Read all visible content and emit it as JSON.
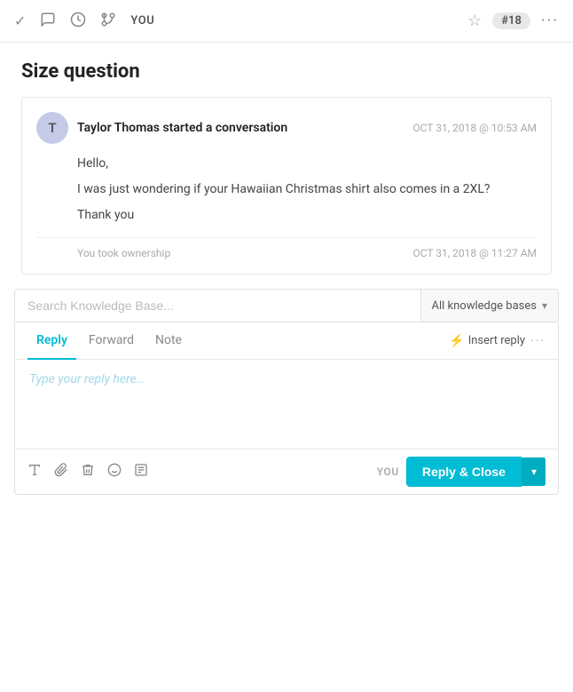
{
  "toolbar": {
    "label": "YOU",
    "ticket_badge": "#18",
    "icons": {
      "check": "✓",
      "chat": "□",
      "clock": "○",
      "fork": "⑂",
      "star": "☆",
      "more": "···"
    }
  },
  "page": {
    "title": "Size question"
  },
  "conversation": {
    "author_initial": "T",
    "author_action": "Taylor Thomas started a conversation",
    "timestamp": "OCT 31, 2018 @ 10:53 AM",
    "lines": [
      "Hello,",
      "I was just wondering if your Hawaiian Christmas shirt also comes in a 2XL?",
      "Thank you"
    ],
    "ownership_text": "You took ownership",
    "ownership_time": "OCT 31, 2018 @ 11:27 AM"
  },
  "knowledge_base": {
    "search_placeholder": "Search Knowledge Base...",
    "dropdown_label": "All knowledge bases",
    "dropdown_arrow": "▾"
  },
  "reply": {
    "tabs": [
      {
        "label": "Reply",
        "active": true
      },
      {
        "label": "Forward",
        "active": false
      },
      {
        "label": "Note",
        "active": false
      }
    ],
    "insert_label": "Insert reply",
    "placeholder": "Type your reply here...",
    "you_label": "YOU",
    "send_label": "Reply & Close",
    "send_dropdown": "▾",
    "tools": {
      "text": "A",
      "attach": "📎",
      "delete": "🗑",
      "emoji": "☺",
      "article": "📄"
    }
  }
}
